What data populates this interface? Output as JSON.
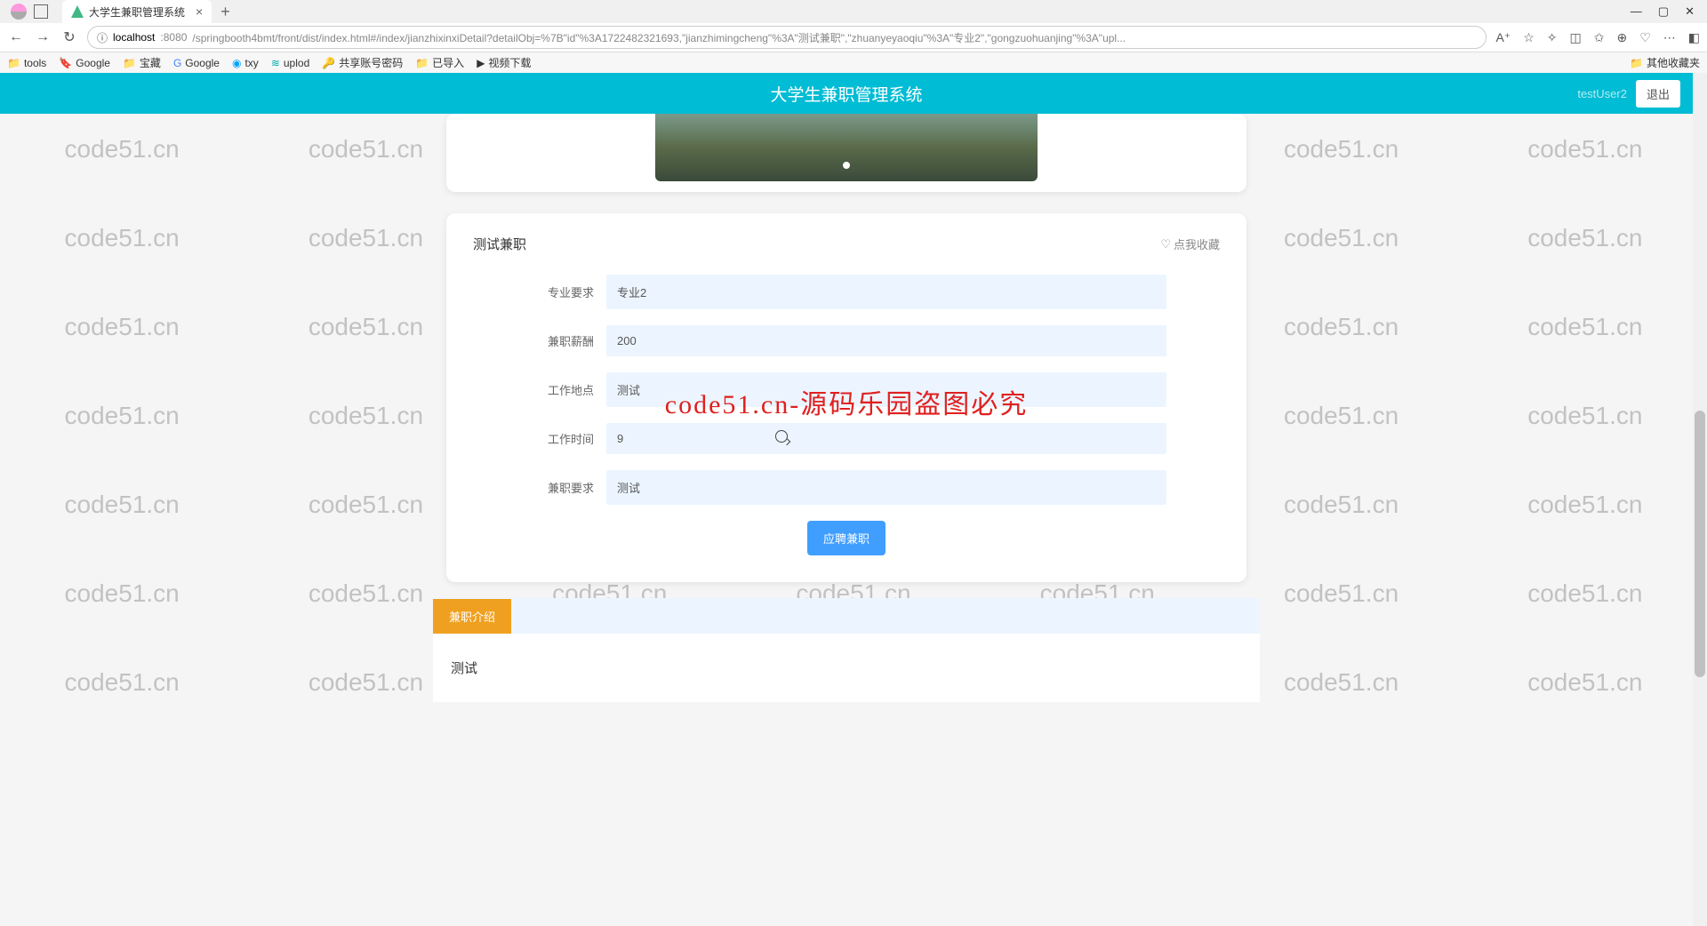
{
  "browser": {
    "tab_title": "大学生兼职管理系统",
    "url_host": "localhost",
    "url_port": ":8080",
    "url_path": "/springbooth4bmt/front/dist/index.html#/index/jianzhixinxiDetail?detailObj=%7B\"id\"%3A1722482321693,\"jianzhimingcheng\"%3A\"测试兼职\",\"zhuanyeyaoqiu\"%3A\"专业2\",\"gongzuohuanjing\"%3A\"upl...",
    "bookmarks": [
      "tools",
      "Google",
      "宝藏",
      "Google",
      "txy",
      "uplod",
      "共享账号密码",
      "已导入",
      "视频下载"
    ],
    "other_bookmarks": "其他收藏夹"
  },
  "header": {
    "title": "大学生兼职管理系统",
    "username": "testUser2",
    "logout": "退出"
  },
  "detail": {
    "title": "测试兼职",
    "favorite": "点我收藏",
    "rows": [
      {
        "label": "专业要求",
        "value": "专业2"
      },
      {
        "label": "兼职薪酬",
        "value": "200"
      },
      {
        "label": "工作地点",
        "value": "测试"
      },
      {
        "label": "工作时间",
        "value": "9"
      },
      {
        "label": "兼职要求",
        "value": "测试"
      }
    ],
    "apply_button": "应聘兼职"
  },
  "section": {
    "tab": "兼职介绍",
    "content": "测试"
  },
  "watermark": "code51.cn",
  "overlay": "code51.cn-源码乐园盗图必究"
}
